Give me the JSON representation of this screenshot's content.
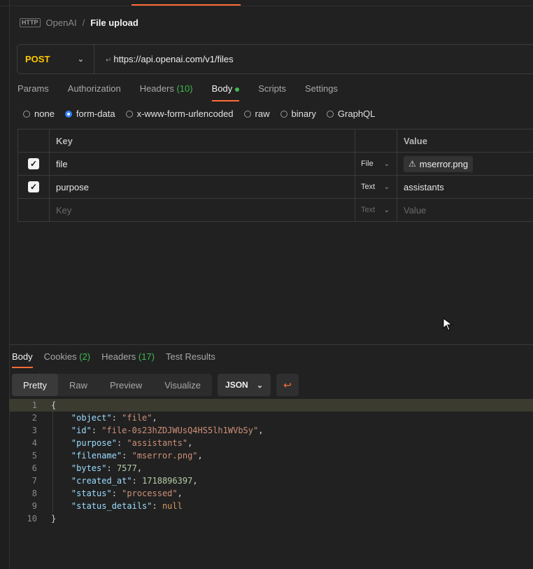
{
  "breadcrumb": {
    "icon": "HTTP",
    "parent": "OpenAI",
    "separator": "/",
    "current": "File upload"
  },
  "request": {
    "method": "POST",
    "url": "https://api.openai.com/v1/files"
  },
  "request_tabs": [
    {
      "label": "Params"
    },
    {
      "label": "Authorization"
    },
    {
      "label": "Headers",
      "count": "(10)"
    },
    {
      "label": "Body",
      "active": true
    },
    {
      "label": "Scripts"
    },
    {
      "label": "Settings"
    }
  ],
  "body_modes": [
    "none",
    "form-data",
    "x-www-form-urlencoded",
    "raw",
    "binary",
    "GraphQL"
  ],
  "body_mode_selected": "form-data",
  "form_table": {
    "headers": {
      "key": "Key",
      "value": "Value"
    },
    "rows": [
      {
        "checked": true,
        "key": "file",
        "type": "File",
        "value": "mserror.png"
      },
      {
        "checked": true,
        "key": "purpose",
        "type": "Text",
        "value": "assistants"
      }
    ],
    "empty_row": {
      "key": "Key",
      "type": "Text",
      "value": "Value"
    }
  },
  "response_tabs": [
    {
      "label": "Body",
      "active": true
    },
    {
      "label": "Cookies",
      "count": "(2)"
    },
    {
      "label": "Headers",
      "count": "(17)"
    },
    {
      "label": "Test Results"
    }
  ],
  "view_options": [
    "Pretty",
    "Raw",
    "Preview",
    "Visualize"
  ],
  "view_selected": "Pretty",
  "format": "JSON",
  "response_lines": [
    {
      "n": "1",
      "text": "{"
    },
    {
      "n": "2",
      "key": "object",
      "value": "\"file\"",
      "kind": "str"
    },
    {
      "n": "3",
      "key": "id",
      "value": "\"file-0s23hZDJWUsQ4HS5lh1WVbSy\"",
      "kind": "str"
    },
    {
      "n": "4",
      "key": "purpose",
      "value": "\"assistants\"",
      "kind": "str"
    },
    {
      "n": "5",
      "key": "filename",
      "value": "\"mserror.png\"",
      "kind": "str"
    },
    {
      "n": "6",
      "key": "bytes",
      "value": "7577",
      "kind": "num"
    },
    {
      "n": "7",
      "key": "created_at",
      "value": "1718896397",
      "kind": "num"
    },
    {
      "n": "8",
      "key": "status",
      "value": "\"processed\"",
      "kind": "str"
    },
    {
      "n": "9",
      "key": "status_details",
      "value": "null",
      "kind": "null",
      "last": true
    },
    {
      "n": "10",
      "text": "}"
    }
  ]
}
